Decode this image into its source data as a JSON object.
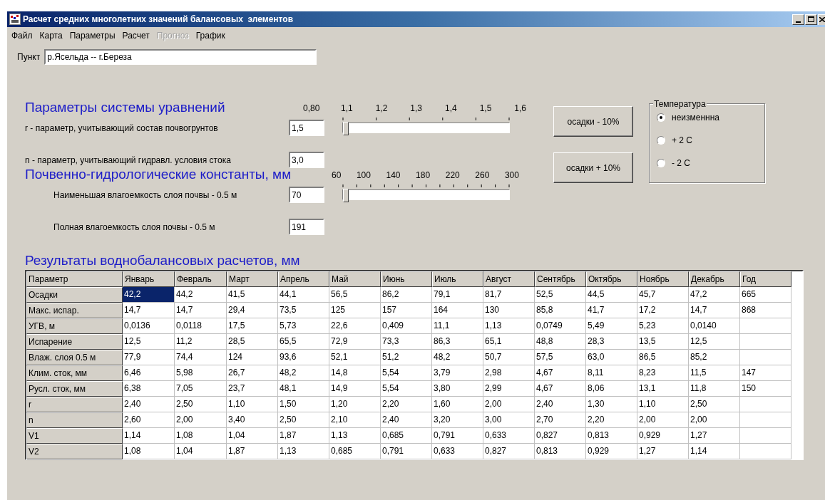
{
  "window": {
    "title": "Расчет средних многолетних значений балансовых  элементов"
  },
  "menu": [
    {
      "label": "Файл",
      "disabled": false
    },
    {
      "label": "Карта",
      "disabled": false
    },
    {
      "label": "Параметры",
      "disabled": false
    },
    {
      "label": "Расчет",
      "disabled": false
    },
    {
      "label": "Прогноз",
      "disabled": true
    },
    {
      "label": "График",
      "disabled": false
    }
  ],
  "point": {
    "label": "Пункт",
    "value": "р.Ясельда -- г.Береза"
  },
  "equation_params": {
    "title": "Параметры системы уравнений",
    "reading": "0,80",
    "slider": {
      "ticks": [
        "1,1",
        "1,2",
        "1,3",
        "1,4",
        "1,5",
        "1,6"
      ],
      "level": 0
    },
    "fields": [
      {
        "label": "r - параметр, учитывающий состав почвогрунтов",
        "value": "1,5"
      },
      {
        "label": "n - параметр, учитывающий гидравл. условия стока",
        "value": "3,0"
      }
    ]
  },
  "soil_constants": {
    "title": "Почвенно-гидрологические константы, мм",
    "slider": {
      "ticks": [
        "60",
        "100",
        "140",
        "180",
        "220",
        "260",
        "300"
      ],
      "level": 0
    },
    "fields": [
      {
        "label": "Наименьшая влагоемкость слоя почвы - 0.5 м",
        "value": "70"
      },
      {
        "label": "Полная влагоемкость слоя почвы - 0.5 м",
        "value": "191"
      }
    ]
  },
  "buttons": [
    "осадки - 10%",
    "осадки + 10%"
  ],
  "temperature": {
    "title": "Температура",
    "options": [
      {
        "label": "неизменнна",
        "selected": true
      },
      {
        "label": "+ 2 С",
        "selected": false
      },
      {
        "label": "- 2 С",
        "selected": false
      }
    ]
  },
  "results": {
    "title": "Результаты воднобалансовых расчетов, мм",
    "columns": [
      "Параметр",
      "Январь",
      "Февраль",
      "Март",
      "Апрель",
      "Май",
      "Июнь",
      "Июль",
      "Август",
      "Сентябрь",
      "Октябрь",
      "Ноябрь",
      "Декабрь",
      "Год"
    ],
    "rows": [
      {
        "cells": [
          {
            "v": "Осадки",
            "selected": false
          },
          {
            "v": "42,2",
            "selected": true
          },
          {
            "v": "44,2",
            "selected": false
          },
          {
            "v": "41,5",
            "selected": false
          },
          {
            "v": "44,1",
            "selected": false
          },
          {
            "v": "56,5",
            "selected": false
          },
          {
            "v": "86,2",
            "selected": false
          },
          {
            "v": "79,1",
            "selected": false
          },
          {
            "v": "81,7",
            "selected": false
          },
          {
            "v": "52,5",
            "selected": false
          },
          {
            "v": "44,5",
            "selected": false
          },
          {
            "v": "45,7",
            "selected": false
          },
          {
            "v": "47,2",
            "selected": false
          },
          {
            "v": "665",
            "selected": false
          }
        ]
      },
      {
        "cells": [
          {
            "v": "Макс. испар.",
            "selected": false
          },
          {
            "v": "14,7",
            "selected": false
          },
          {
            "v": "14,7",
            "selected": false
          },
          {
            "v": "29,4",
            "selected": false
          },
          {
            "v": "73,5",
            "selected": false
          },
          {
            "v": "125",
            "selected": false
          },
          {
            "v": "157",
            "selected": false
          },
          {
            "v": "164",
            "selected": false
          },
          {
            "v": "130",
            "selected": false
          },
          {
            "v": "85,8",
            "selected": false
          },
          {
            "v": "41,7",
            "selected": false
          },
          {
            "v": "17,2",
            "selected": false
          },
          {
            "v": "14,7",
            "selected": false
          },
          {
            "v": "868",
            "selected": false
          }
        ]
      },
      {
        "cells": [
          {
            "v": "УГВ, м",
            "selected": false
          },
          {
            "v": "0,0136",
            "selected": false
          },
          {
            "v": "0,0118",
            "selected": false
          },
          {
            "v": "17,5",
            "selected": false
          },
          {
            "v": "5,73",
            "selected": false
          },
          {
            "v": "22,6",
            "selected": false
          },
          {
            "v": "0,409",
            "selected": false
          },
          {
            "v": "11,1",
            "selected": false
          },
          {
            "v": "1,13",
            "selected": false
          },
          {
            "v": "0,0749",
            "selected": false
          },
          {
            "v": "5,49",
            "selected": false
          },
          {
            "v": "5,23",
            "selected": false
          },
          {
            "v": "0,0140",
            "selected": false
          }
        ]
      },
      {
        "cells": [
          {
            "v": "Испарение",
            "selected": false
          },
          {
            "v": "12,5",
            "selected": false
          },
          {
            "v": "11,2",
            "selected": false
          },
          {
            "v": "28,5",
            "selected": false
          },
          {
            "v": "65,5",
            "selected": false
          },
          {
            "v": "72,9",
            "selected": false
          },
          {
            "v": "73,3",
            "selected": false
          },
          {
            "v": "86,3",
            "selected": false
          },
          {
            "v": "65,1",
            "selected": false
          },
          {
            "v": "48,8",
            "selected": false
          },
          {
            "v": "28,3",
            "selected": false
          },
          {
            "v": "13,5",
            "selected": false
          },
          {
            "v": "12,5",
            "selected": false
          }
        ]
      },
      {
        "cells": [
          {
            "v": "Влаж. слоя 0.5 м",
            "selected": false
          },
          {
            "v": "77,9",
            "selected": false
          },
          {
            "v": "74,4",
            "selected": false
          },
          {
            "v": "124",
            "selected": false
          },
          {
            "v": "93,6",
            "selected": false
          },
          {
            "v": "52,1",
            "selected": false
          },
          {
            "v": "51,2",
            "selected": false
          },
          {
            "v": "48,2",
            "selected": false
          },
          {
            "v": "50,7",
            "selected": false
          },
          {
            "v": "57,5",
            "selected": false
          },
          {
            "v": "63,0",
            "selected": false
          },
          {
            "v": "86,5",
            "selected": false
          },
          {
            "v": "85,2",
            "selected": false
          }
        ]
      },
      {
        "cells": [
          {
            "v": "Клим. сток, мм",
            "selected": false
          },
          {
            "v": "6,46",
            "selected": false
          },
          {
            "v": "5,98",
            "selected": false
          },
          {
            "v": "26,7",
            "selected": false
          },
          {
            "v": "48,2",
            "selected": false
          },
          {
            "v": "14,8",
            "selected": false
          },
          {
            "v": "5,54",
            "selected": false
          },
          {
            "v": "3,79",
            "selected": false
          },
          {
            "v": "2,98",
            "selected": false
          },
          {
            "v": "4,67",
            "selected": false
          },
          {
            "v": "8,11",
            "selected": false
          },
          {
            "v": "8,23",
            "selected": false
          },
          {
            "v": "11,5",
            "selected": false
          },
          {
            "v": "147",
            "selected": false
          }
        ]
      },
      {
        "cells": [
          {
            "v": "Русл. сток, мм",
            "selected": false
          },
          {
            "v": "6,38",
            "selected": false
          },
          {
            "v": "7,05",
            "selected": false
          },
          {
            "v": "23,7",
            "selected": false
          },
          {
            "v": "48,1",
            "selected": false
          },
          {
            "v": "14,9",
            "selected": false
          },
          {
            "v": "5,54",
            "selected": false
          },
          {
            "v": "3,80",
            "selected": false
          },
          {
            "v": "2,99",
            "selected": false
          },
          {
            "v": "4,67",
            "selected": false
          },
          {
            "v": "8,06",
            "selected": false
          },
          {
            "v": "13,1",
            "selected": false
          },
          {
            "v": "11,8",
            "selected": false
          },
          {
            "v": "150",
            "selected": false
          }
        ]
      },
      {
        "cells": [
          {
            "v": "r",
            "selected": false
          },
          {
            "v": "2,40",
            "selected": false
          },
          {
            "v": "2,50",
            "selected": false
          },
          {
            "v": "1,10",
            "selected": false
          },
          {
            "v": "1,50",
            "selected": false
          },
          {
            "v": "1,20",
            "selected": false
          },
          {
            "v": "2,20",
            "selected": false
          },
          {
            "v": "1,60",
            "selected": false
          },
          {
            "v": "2,00",
            "selected": false
          },
          {
            "v": "2,40",
            "selected": false
          },
          {
            "v": "1,30",
            "selected": false
          },
          {
            "v": "1,10",
            "selected": false
          },
          {
            "v": "2,50",
            "selected": false
          }
        ]
      },
      {
        "cells": [
          {
            "v": "n",
            "selected": false
          },
          {
            "v": "2,60",
            "selected": false
          },
          {
            "v": "2,00",
            "selected": false
          },
          {
            "v": "3,40",
            "selected": false
          },
          {
            "v": "2,50",
            "selected": false
          },
          {
            "v": "2,10",
            "selected": false
          },
          {
            "v": "2,40",
            "selected": false
          },
          {
            "v": "3,20",
            "selected": false
          },
          {
            "v": "3,00",
            "selected": false
          },
          {
            "v": "2,70",
            "selected": false
          },
          {
            "v": "2,20",
            "selected": false
          },
          {
            "v": "2,00",
            "selected": false
          },
          {
            "v": "2,00",
            "selected": false
          }
        ]
      },
      {
        "cells": [
          {
            "v": "V1",
            "selected": false
          },
          {
            "v": "1,14",
            "selected": false
          },
          {
            "v": "1,08",
            "selected": false
          },
          {
            "v": "1,04",
            "selected": false
          },
          {
            "v": "1,87",
            "selected": false
          },
          {
            "v": "1,13",
            "selected": false
          },
          {
            "v": "0,685",
            "selected": false
          },
          {
            "v": "0,791",
            "selected": false
          },
          {
            "v": "0,633",
            "selected": false
          },
          {
            "v": "0,827",
            "selected": false
          },
          {
            "v": "0,813",
            "selected": false
          },
          {
            "v": "0,929",
            "selected": false
          },
          {
            "v": "1,27",
            "selected": false
          }
        ]
      },
      {
        "cells": [
          {
            "v": "V2",
            "selected": false
          },
          {
            "v": "1,08",
            "selected": false
          },
          {
            "v": "1,04",
            "selected": false
          },
          {
            "v": "1,87",
            "selected": false
          },
          {
            "v": "1,13",
            "selected": false
          },
          {
            "v": "0,685",
            "selected": false
          },
          {
            "v": "0,791",
            "selected": false
          },
          {
            "v": "0,633",
            "selected": false
          },
          {
            "v": "0,827",
            "selected": false
          },
          {
            "v": "0,813",
            "selected": false
          },
          {
            "v": "0,929",
            "selected": false
          },
          {
            "v": "1,27",
            "selected": false
          },
          {
            "v": "1,14",
            "selected": false
          }
        ]
      }
    ]
  }
}
